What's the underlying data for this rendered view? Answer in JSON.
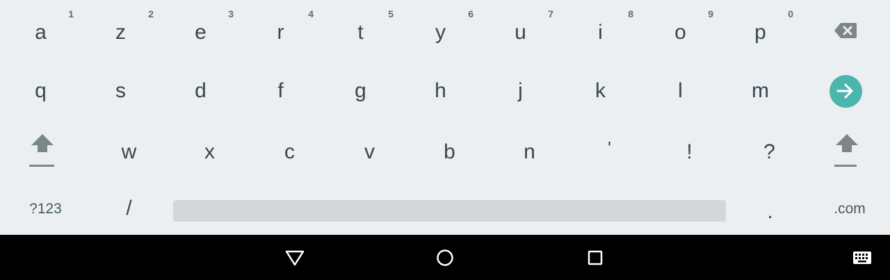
{
  "keyboard": {
    "row1": [
      {
        "label": "a",
        "hint": "1"
      },
      {
        "label": "z",
        "hint": "2"
      },
      {
        "label": "e",
        "hint": "3"
      },
      {
        "label": "r",
        "hint": "4"
      },
      {
        "label": "t",
        "hint": "5"
      },
      {
        "label": "y",
        "hint": "6"
      },
      {
        "label": "u",
        "hint": "7"
      },
      {
        "label": "i",
        "hint": "8"
      },
      {
        "label": "o",
        "hint": "9"
      },
      {
        "label": "p",
        "hint": "0"
      }
    ],
    "row2": [
      "q",
      "s",
      "d",
      "f",
      "g",
      "h",
      "j",
      "k",
      "l",
      "m"
    ],
    "row3": [
      "w",
      "x",
      "c",
      "v",
      "b",
      "n",
      "'",
      "!",
      "?"
    ],
    "row4": {
      "symbols_label": "?123",
      "slash_label": "/",
      "period_label": ".",
      "dotcom_label": ".com"
    },
    "icons": {
      "backspace": "backspace-icon",
      "enter": "arrow-right-icon",
      "shift": "shift-icon"
    },
    "colors": {
      "background": "#eceff1",
      "key_text": "#37474f",
      "enter_accent": "#4db6ac",
      "spacebar": "#d3d7d9"
    }
  },
  "navbar": {
    "icons": [
      "back-triangle-icon",
      "home-circle-icon",
      "recents-square-icon",
      "keyboard-switch-icon"
    ]
  }
}
